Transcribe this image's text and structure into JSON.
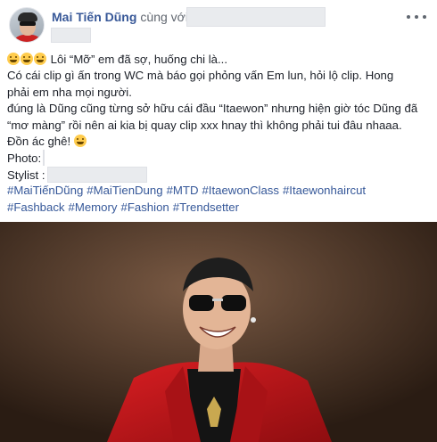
{
  "post": {
    "author": {
      "name": "Mai Tiến Dũng",
      "with_text": "cùng với"
    },
    "lines": [
      {
        "emojis": 3,
        "text": " Lôi “Mỡ” em đã sợ, huống chi là..."
      },
      {
        "text": "Có cái clip gì ấn trong WC mà báo gọi phỏng vấn Em lun, hỏi lộ clip. Hong"
      },
      {
        "text": "phải em nha mọi người."
      },
      {
        "text": "đúng là Dũng cũng từng sở hữu cái đầu “Itaewon” nhưng hiện giờ tóc Dũng đã"
      },
      {
        "text": "“mơ màng” rồi nên ai kia bị quay clip xxx hnay thì không phải tui đâu nhaaa."
      },
      {
        "text": "Đồn ác ghê!",
        "emoji_after": true
      }
    ],
    "photo_label": "Photo:",
    "stylist_label": "Stylist :",
    "hashtags_row1": [
      "#MaiTiếnDũng",
      "#MaiTienDung",
      "#MTD",
      "#ItaewonClass",
      "#Itaewonhaircut"
    ],
    "hashtags_row2": [
      "#Fashback",
      "#Memory",
      "#Fashion",
      "#Trendsetter"
    ]
  },
  "colors": {
    "link": "#385898",
    "hashtag": "#365899",
    "text": "#1d2129",
    "meta": "#616770",
    "jacket": "#c4161c",
    "background_photo": "#4a3426"
  },
  "icons": {
    "more": "more-horizontal-icon",
    "emoji": "laughing-emoji-icon"
  }
}
